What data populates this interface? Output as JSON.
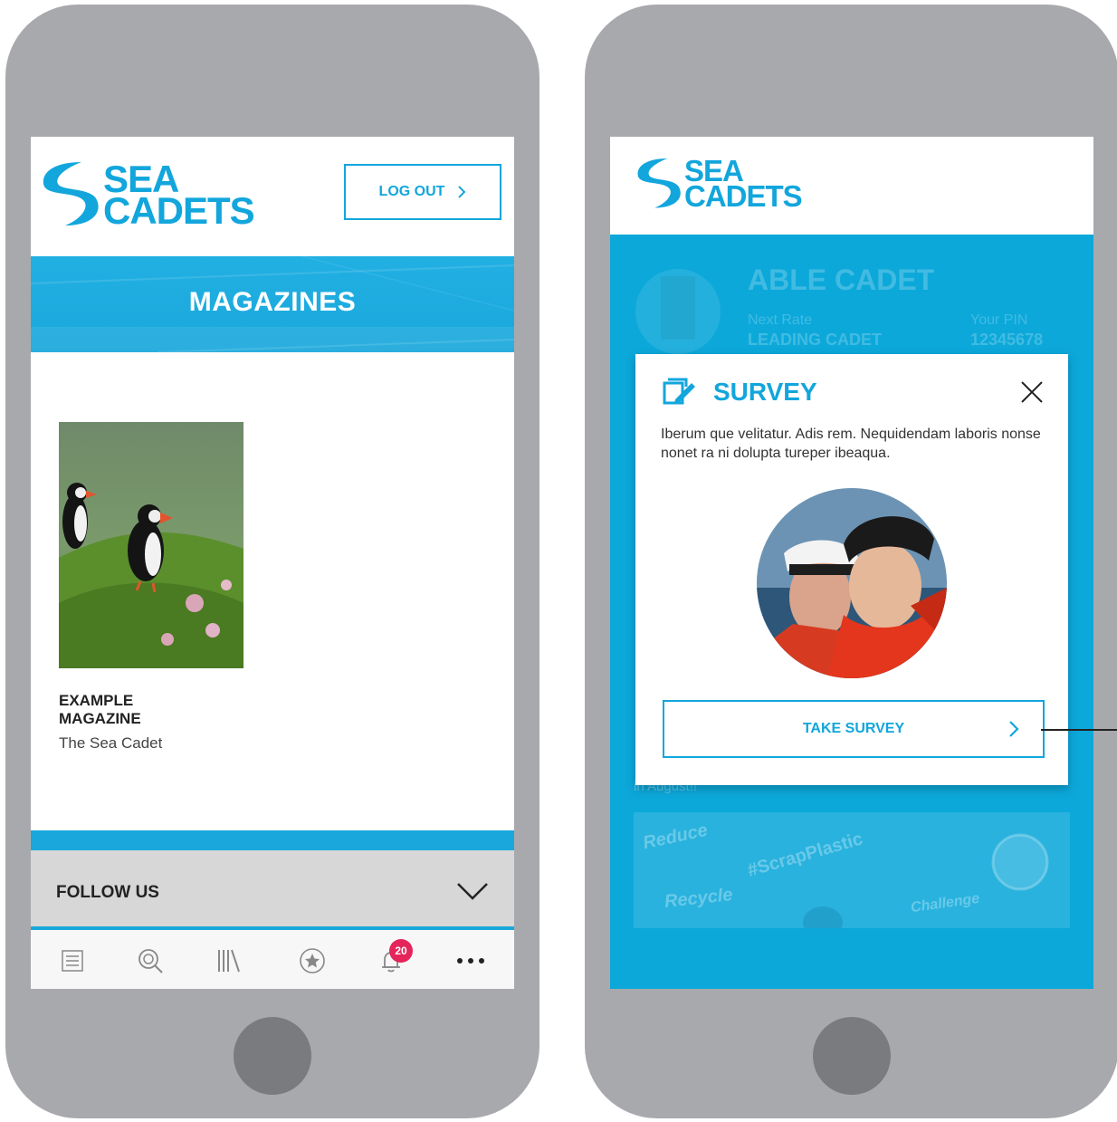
{
  "left": {
    "logo": {
      "line1": "SEA",
      "line2": "CADETS"
    },
    "logout_label": "LOG OUT",
    "banner_title": "MAGAZINES",
    "magazine": {
      "title_line1": "EXAMPLE",
      "title_line2": "MAGAZINE",
      "subtitle": "The Sea Cadet"
    },
    "follow_label": "FOLLOW US",
    "tabbar": {
      "notification_count": "20"
    }
  },
  "right": {
    "logo": {
      "line1": "SEA",
      "line2": "CADETS"
    },
    "profile": {
      "rank": "ABLE CADET",
      "next_rate_label": "Next Rate",
      "next_rate_value": "LEADING CADET",
      "pin_label": "Your PIN",
      "pin_value": "12345678"
    },
    "behind_text": "in August!!",
    "promo": {
      "word1": "Reduce",
      "word2": "Recycle",
      "hashtag": "#ScrapPlastic",
      "word3": "Challenge"
    },
    "modal": {
      "title": "SURVEY",
      "body": "Iberum que velitatur. Adis rem. Nequidendam laboris nonse nonet ra ni dolupta tureper ibeaqua.",
      "button_label": "TAKE SURVEY"
    }
  },
  "colors": {
    "brand_blue": "#12a6dc",
    "badge_red": "#e4245a",
    "phone_grey": "#a8a9ad"
  }
}
